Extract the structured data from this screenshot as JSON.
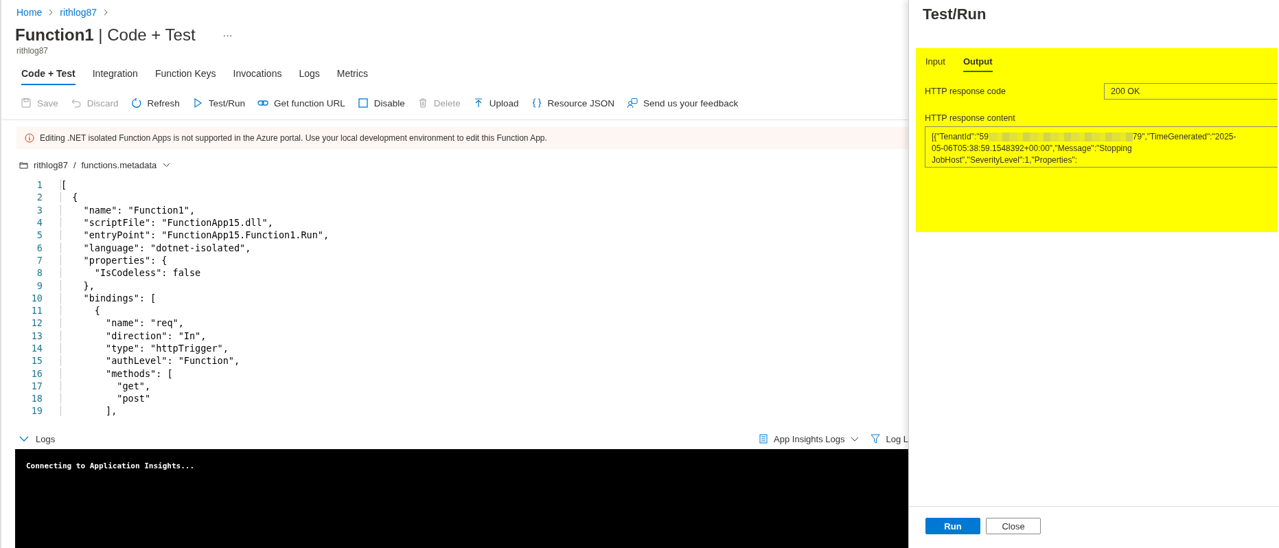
{
  "breadcrumb": [
    "Home",
    "rithlog87"
  ],
  "title": {
    "name": "Function1",
    "separator": "|",
    "section": "Code + Test",
    "more": "···"
  },
  "subtitle": "rithlog87",
  "tabs": [
    {
      "label": "Code + Test",
      "selected": true
    },
    {
      "label": "Integration",
      "selected": false
    },
    {
      "label": "Function Keys",
      "selected": false
    },
    {
      "label": "Invocations",
      "selected": false
    },
    {
      "label": "Logs",
      "selected": false
    },
    {
      "label": "Metrics",
      "selected": false
    }
  ],
  "toolbar": [
    {
      "label": "Save",
      "disabled": true
    },
    {
      "label": "Discard",
      "disabled": true
    },
    {
      "label": "Refresh",
      "disabled": false
    },
    {
      "label": "Test/Run",
      "disabled": false
    },
    {
      "label": "Get function URL",
      "disabled": false
    },
    {
      "label": "Disable",
      "disabled": false
    },
    {
      "label": "Delete",
      "disabled": true
    },
    {
      "label": "Upload",
      "disabled": false
    },
    {
      "label": "Resource JSON",
      "disabled": false
    },
    {
      "label": "Send us your feedback",
      "disabled": false
    }
  ],
  "warning": "Editing .NET isolated Function Apps is not supported in the Azure portal. Use your local development environment to edit this Function App.",
  "file_path": [
    "rithlog87",
    "/",
    "functions.metadata"
  ],
  "code_lines": [
    {
      "number": "1",
      "text": "["
    },
    {
      "number": "2",
      "text": "  {"
    },
    {
      "number": "3",
      "text": "    \"name\": \"Function1\","
    },
    {
      "number": "4",
      "text": "    \"scriptFile\": \"FunctionApp15.dll\","
    },
    {
      "number": "5",
      "text": "    \"entryPoint\": \"FunctionApp15.Function1.Run\","
    },
    {
      "number": "6",
      "text": "    \"language\": \"dotnet-isolated\","
    },
    {
      "number": "7",
      "text": "    \"properties\": {"
    },
    {
      "number": "8",
      "text": "      \"IsCodeless\": false"
    },
    {
      "number": "9",
      "text": "    },"
    },
    {
      "number": "10",
      "text": "    \"bindings\": ["
    },
    {
      "number": "11",
      "text": "      {"
    },
    {
      "number": "12",
      "text": "        \"name\": \"req\","
    },
    {
      "number": "13",
      "text": "        \"direction\": \"In\","
    },
    {
      "number": "14",
      "text": "        \"type\": \"httpTrigger\","
    },
    {
      "number": "15",
      "text": "        \"authLevel\": \"Function\","
    },
    {
      "number": "16",
      "text": "        \"methods\": ["
    },
    {
      "number": "17",
      "text": "          \"get\","
    },
    {
      "number": "18",
      "text": "          \"post\""
    },
    {
      "number": "19",
      "text": "        ],"
    }
  ],
  "logs": {
    "label": "Logs",
    "expanded": true,
    "source": "App Insights Logs",
    "filter": "Log L",
    "console": "Connecting to Application Insights..."
  },
  "panel": {
    "title": "Test/Run",
    "tabs": [
      {
        "label": "Input",
        "selected": false
      },
      {
        "label": "Output",
        "selected": true
      }
    ],
    "response_code_label": "HTTP response code",
    "response_code": "200 OK",
    "response_content_label": "HTTP response content",
    "response_content": [
      "[{\"TenantId\":\"59",
      "79\",\"TimeGenerated\":\"2025-05-06T05:38:59.1548392+00:00\",\"Message\":\"Stopping JobHost\",\"SeverityLevel\":1,\"Properties\":"
    ],
    "buttons": [
      {
        "label": "Run",
        "kind": "primary"
      },
      {
        "label": "Close",
        "kind": "secondary"
      }
    ]
  }
}
